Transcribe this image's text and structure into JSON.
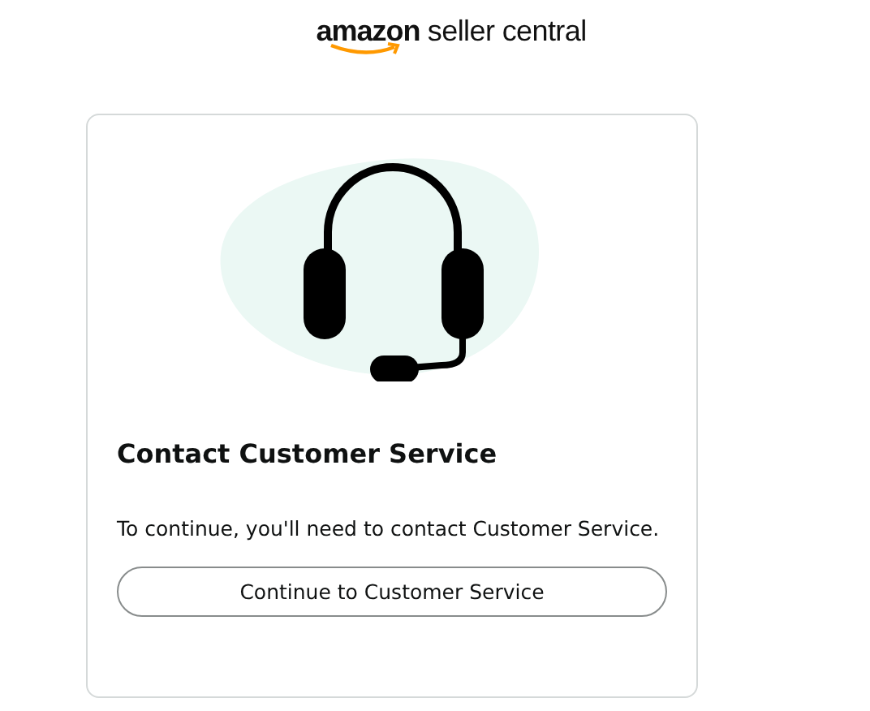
{
  "logo": {
    "text": "**amazon** seller central"
  },
  "card": {
    "illustration": {
      "kind": "headset"
    },
    "title": "Contact Customer Service",
    "message": "To continue, you'll need to contact Customer Service.",
    "button": "Continue to Customer Service"
  }
}
